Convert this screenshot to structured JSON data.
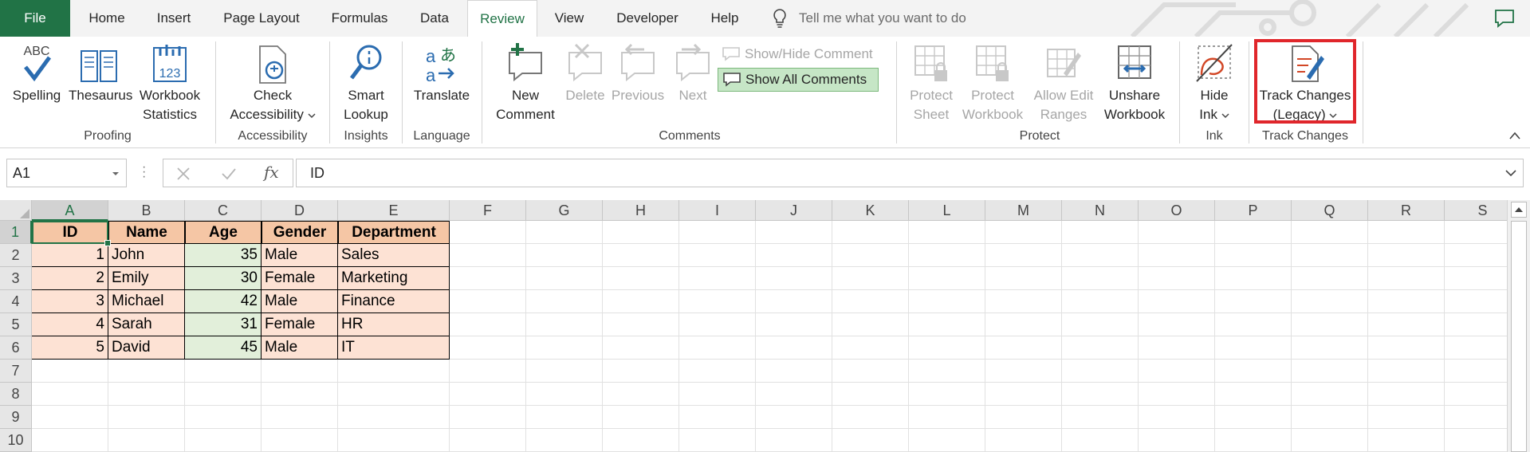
{
  "tabs": {
    "file": "File",
    "home": "Home",
    "insert": "Insert",
    "page_layout": "Page Layout",
    "formulas": "Formulas",
    "data": "Data",
    "review": "Review",
    "view": "View",
    "developer": "Developer",
    "help": "Help",
    "tell_me": "Tell me what you want to do"
  },
  "ribbon": {
    "proofing": {
      "label": "Proofing",
      "spelling": "Spelling",
      "thesaurus": "Thesaurus",
      "workbook_stats_1": "Workbook",
      "workbook_stats_2": "Statistics",
      "abc": "ABC",
      "num": "123"
    },
    "accessibility": {
      "label": "Accessibility",
      "check_1": "Check",
      "check_2": "Accessibility"
    },
    "insights": {
      "label": "Insights",
      "smart_1": "Smart",
      "smart_2": "Lookup"
    },
    "language": {
      "label": "Language",
      "translate": "Translate"
    },
    "comments": {
      "label": "Comments",
      "new_1": "New",
      "new_2": "Comment",
      "delete": "Delete",
      "previous": "Previous",
      "next": "Next",
      "show_hide": "Show/Hide Comment",
      "show_all": "Show All Comments"
    },
    "protect": {
      "label": "Protect",
      "sheet_1": "Protect",
      "sheet_2": "Sheet",
      "workbook_1": "Protect",
      "workbook_2": "Workbook",
      "allow_1": "Allow Edit",
      "allow_2": "Ranges",
      "unshare_1": "Unshare",
      "unshare_2": "Workbook"
    },
    "ink": {
      "label": "Ink",
      "hide_1": "Hide",
      "hide_2": "Ink"
    },
    "track_changes": {
      "label": "Track Changes",
      "btn_1": "Track Changes",
      "btn_2": "(Legacy)"
    }
  },
  "formula_bar": {
    "name_box": "A1",
    "fx": "fx",
    "content": "ID"
  },
  "sheet": {
    "columns": [
      "A",
      "B",
      "C",
      "D",
      "E",
      "F",
      "G",
      "H",
      "I",
      "J",
      "K",
      "L",
      "M",
      "N",
      "O",
      "P",
      "Q",
      "R",
      "S"
    ],
    "rows": [
      "1",
      "2",
      "3",
      "4",
      "5",
      "6",
      "7",
      "8",
      "9",
      "10"
    ],
    "header": [
      "ID",
      "Name",
      "Age",
      "Gender",
      "Department"
    ],
    "data": [
      [
        "1",
        "John",
        "35",
        "Male",
        "Sales"
      ],
      [
        "2",
        "Emily",
        "30",
        "Female",
        "Marketing"
      ],
      [
        "3",
        "Michael",
        "42",
        "Male",
        "Finance"
      ],
      [
        "4",
        "Sarah",
        "31",
        "Female",
        "HR"
      ],
      [
        "5",
        "David",
        "45",
        "Male",
        "IT"
      ]
    ]
  },
  "colors": {
    "excel_green": "#217346",
    "header_fill": "#f5c6a5",
    "data_fill": "#fde2d4",
    "age_fill": "#e2efda",
    "highlight": "#e0262b"
  }
}
